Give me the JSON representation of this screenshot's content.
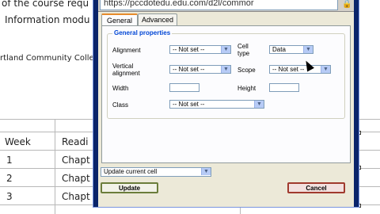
{
  "document": {
    "line1": "of the course requ",
    "line2": "Information modu",
    "line3": "rtland Community College",
    "table": {
      "header": [
        "Week",
        "Readi"
      ],
      "rows": [
        [
          "1",
          "Chapt"
        ],
        [
          "2",
          "Chapt"
        ],
        [
          "3",
          "Chapt"
        ]
      ]
    }
  },
  "dialog": {
    "url": "https://pccdotedu.edu.com/d2l/commor",
    "tabs": [
      "General",
      "Advanced"
    ],
    "legend": "General properties",
    "fields": {
      "alignment_label": "Alignment",
      "alignment_value": "-- Not set --",
      "cell_type_label": "Cell type",
      "cell_type_value": "Data",
      "vertical_alignment_label": "Vertical alignment",
      "vertical_alignment_value": "-- Not set --",
      "scope_label": "Scope",
      "scope_value": "-- Not set --",
      "width_label": "Width",
      "height_label": "Height",
      "class_label": "Class",
      "class_value": "-- Not set --"
    },
    "update_scope": "Update current cell",
    "update_button": "Update",
    "cancel_button": "Cancel"
  },
  "icons": {
    "dropdown": "chevron-down-icon",
    "lock": "lock-icon",
    "cursor": "mouse-pointer-icon"
  },
  "colors": {
    "active_tab_accent": "#e68b2c",
    "legend_text": "#0046d5",
    "dialog_bg": "#ece9d8"
  }
}
